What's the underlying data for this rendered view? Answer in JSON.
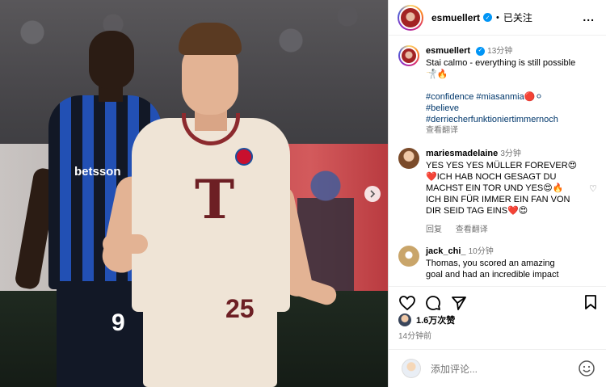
{
  "header": {
    "username": "esmuellert",
    "follow_state": "已关注",
    "separator": "•",
    "more": "..."
  },
  "caption": {
    "username": "esmuellert",
    "time": "13分钟",
    "line1": "Stai calmo - everything is still possible",
    "line2": "🤺🔥",
    "tags": [
      "#confidence #miasanmia🔴⚪",
      "#believe",
      "#derriecherfunktioniertimmernoch"
    ],
    "translate": "查看翻译"
  },
  "comments": [
    {
      "username": "mariesmadelaine",
      "time": "3分钟",
      "lines": [
        "YES YES YES MÜLLER FOREVER😍",
        "❤️ICH HAB NOCH GESAGT DU",
        "MACHST EIN TOR UND YES😍🔥",
        "ICH BIN FÜR IMMER EIN FAN VON",
        "DIR SEID TAG EINS❤️😍"
      ],
      "reply": "回复",
      "translate": "查看翻译",
      "heart": "♡"
    },
    {
      "username": "jack_chi_",
      "time": "10分钟",
      "lines": [
        "Thomas, you scored an amazing",
        "goal and had an incredible impact"
      ]
    }
  ],
  "actions": {
    "likes": "1.6万次赞",
    "posted": "14分钟前"
  },
  "add_comment": {
    "placeholder": "添加评论..."
  },
  "photo": {
    "sponsor": "betsson",
    "inter_number": "9",
    "bayern_number": "25",
    "shirt_logo": "T"
  },
  "colors": {
    "verified": "#0095f6",
    "link": "#00376b",
    "bayern_red": "#6d1f24",
    "inter_blue": "#2250b4"
  }
}
